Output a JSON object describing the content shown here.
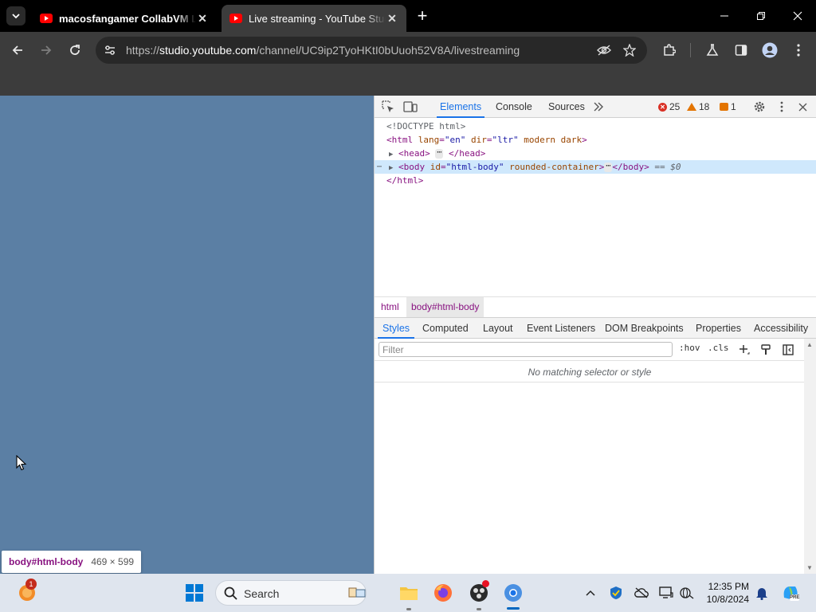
{
  "browser": {
    "tabs": [
      {
        "title": "macosfangamer CollabVM Live"
      },
      {
        "title": "Live streaming - YouTube Studio"
      }
    ],
    "url_prefix": "https://",
    "url_host": "studio.youtube.com",
    "url_path": "/channel/UC9ip2TyoHKtI0bUuoh52V8A/livestreaming"
  },
  "page": {
    "background": "#5b7fa4",
    "inspect_tooltip": {
      "selector": "body#html-body",
      "size": "469 × 599"
    }
  },
  "devtools": {
    "tabs": [
      "Elements",
      "Console",
      "Sources"
    ],
    "errors": "25",
    "warnings": "18",
    "issues": "1",
    "dom": {
      "doctype": "<!DOCTYPE html>",
      "html_open_tag": "html",
      "html_attr1_name": "lang",
      "html_attr1_value": "\"en\"",
      "html_attr2_name": "dir",
      "html_attr2_value": "\"ltr\"",
      "html_attr3_name": "modern dark",
      "head_open": "<head>",
      "head_close": "</head>",
      "body_open_tag": "body",
      "body_attr_name": "id",
      "body_attr_value": "\"html-body\"",
      "body_attr2_name": "rounded-container",
      "body_close": "</body>",
      "body_suffix": "== $0",
      "html_close": "</html>"
    },
    "breadcrumbs": [
      "html",
      "body#html-body"
    ],
    "panel_tabs": [
      "Styles",
      "Computed",
      "Layout",
      "Event Listeners",
      "DOM Breakpoints",
      "Properties",
      "Accessibility"
    ],
    "filter_placeholder": "Filter",
    "hov": ":hov",
    "cls": ".cls",
    "no_match": "No matching selector or style"
  },
  "taskbar": {
    "search_label": "Search",
    "time": "12:35 PM",
    "date": "10/8/2024",
    "notification_count": "1"
  },
  "colors": {
    "accent": "#1a73e8",
    "tag": "#881280",
    "attr_name": "#994500",
    "attr_value": "#1a1aa6",
    "youtube_red": "#ff0000"
  }
}
